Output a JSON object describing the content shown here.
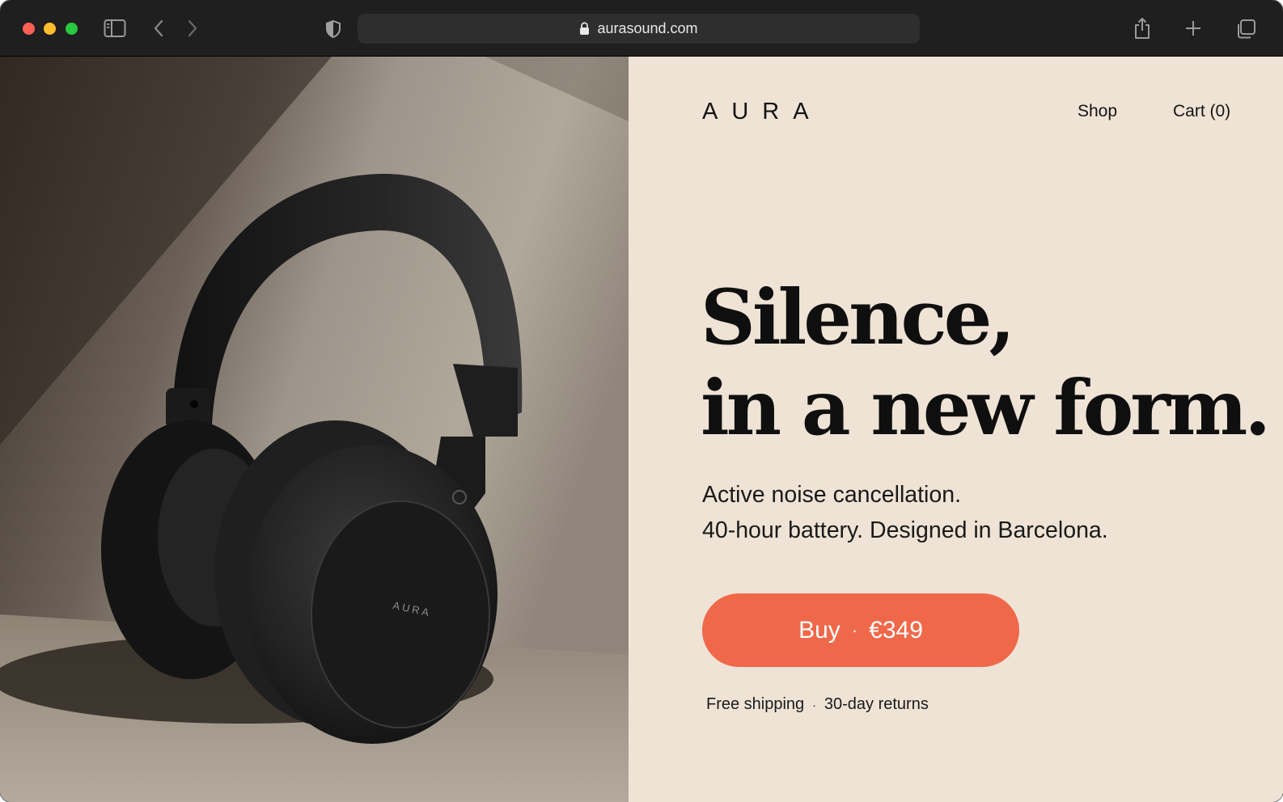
{
  "browser": {
    "url": "aurasound.com",
    "icons": {
      "sidebar": "sidebar-icon",
      "back": "chevron-left-icon",
      "forward": "chevron-right-icon",
      "privacy": "shield-icon",
      "lock": "lock-icon",
      "share": "share-icon",
      "new_tab": "plus-icon",
      "tabs": "tab-overview-icon"
    }
  },
  "header": {
    "logo": "AURA",
    "nav": [
      {
        "label": "Shop"
      },
      {
        "label": "Cart (0)"
      }
    ]
  },
  "hero": {
    "image_alt": "Black over-ear headphones",
    "headline_line1": "Silence,",
    "headline_line2": "in a new form.",
    "sub_line1": "Active noise cancellation.",
    "sub_line2": "40-hour battery. Designed in Barcelona.",
    "cta_label": "Buy",
    "cta_separator": "·",
    "cta_price": "€349",
    "shipping": "Free shipping",
    "shipping_separator": "·",
    "returns": "30-day returns",
    "earcup_brand": "AURA"
  },
  "colors": {
    "accent": "#f0684a",
    "panel_bg": "#efe3d5",
    "text": "#141414"
  }
}
